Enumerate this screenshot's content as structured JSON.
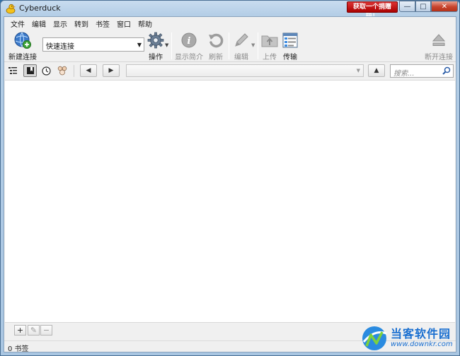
{
  "window": {
    "title": "Cyberduck",
    "donate_label": "获取一个捐赠码！",
    "controls": {
      "minimize": "—",
      "maximize": "□",
      "close": "✕"
    }
  },
  "menu": [
    "文件",
    "编辑",
    "显示",
    "转到",
    "书签",
    "窗口",
    "帮助"
  ],
  "toolbar": {
    "new_connection": "新建连接",
    "quick_connect": "快速连接",
    "action": "操作",
    "get_info": "显示简介",
    "refresh": "刷新",
    "edit": "编辑",
    "upload": "上传",
    "transfers": "传输",
    "disconnect": "断开连接"
  },
  "navbar": {
    "search_placeholder": "搜索...",
    "back_glyph": "◀",
    "forward_glyph": "▶",
    "up_glyph": "▲"
  },
  "bottombar": {
    "add": "+",
    "edit": "✎",
    "remove": "−"
  },
  "status": {
    "text": "0 书签"
  },
  "watermark": {
    "title": "当客软件园",
    "url": "www.downkr.com"
  },
  "colors": {
    "titlebar": "#c9dcef",
    "close_button": "#c8432c",
    "donate_button": "#b50000",
    "watermark_blue": "#1a6fd0"
  }
}
